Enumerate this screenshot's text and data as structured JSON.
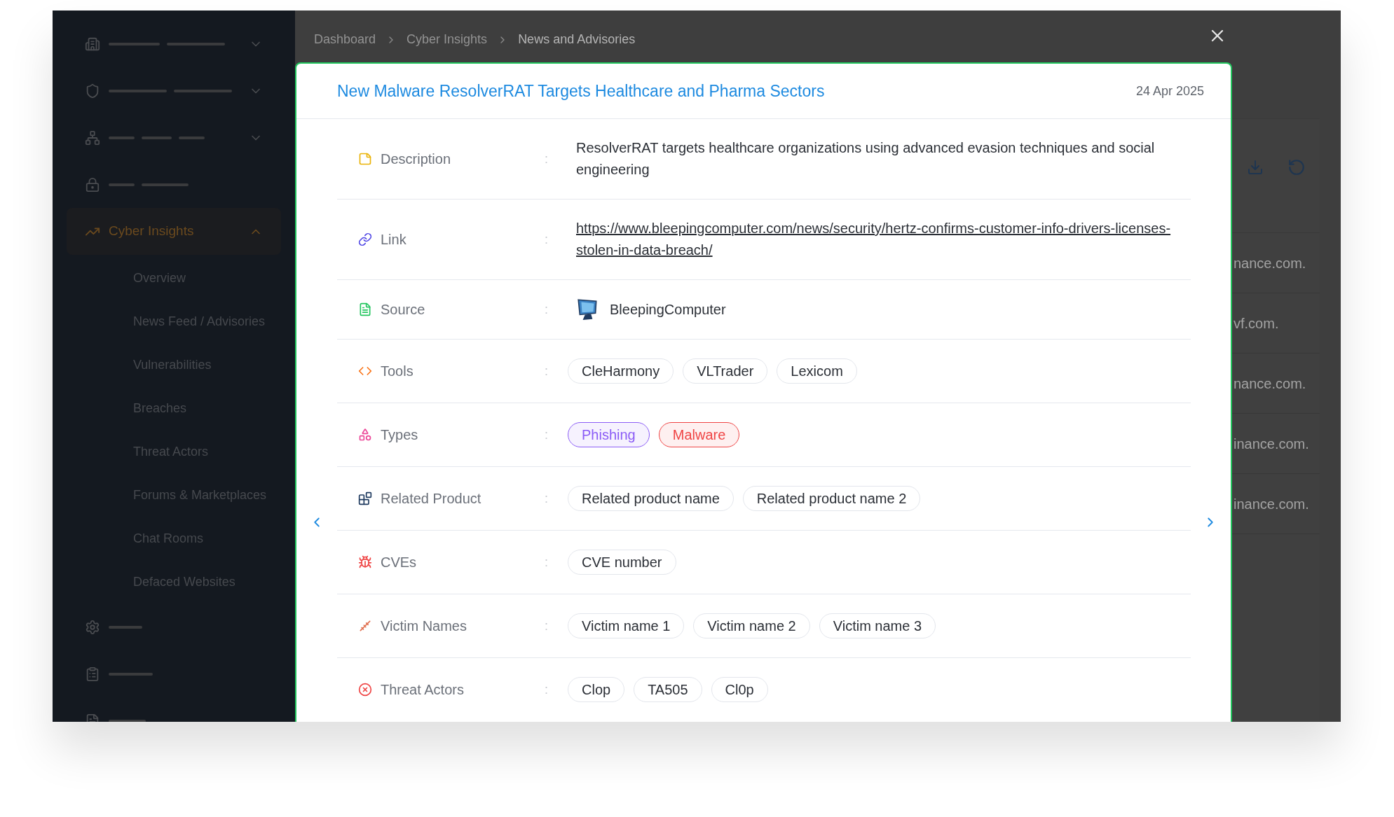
{
  "sidebar": {
    "items": [
      {
        "kind": "group",
        "expanded": false
      },
      {
        "kind": "group",
        "expanded": false
      },
      {
        "kind": "group",
        "expanded": false
      },
      {
        "kind": "link"
      },
      {
        "kind": "group",
        "label": "Cyber Insights",
        "expanded": true,
        "selected": true,
        "children": [
          {
            "label": "Overview"
          },
          {
            "label": "News Feed / Advisories"
          },
          {
            "label": "Vulnerabilities"
          },
          {
            "label": "Breaches"
          },
          {
            "label": "Threat Actors"
          },
          {
            "label": "Forums & Marketplaces"
          },
          {
            "label": "Chat Rooms"
          },
          {
            "label": "Defaced Websites"
          }
        ]
      },
      {
        "kind": "link"
      },
      {
        "kind": "link"
      },
      {
        "kind": "link"
      }
    ]
  },
  "breadcrumb": [
    "Dashboard",
    "Cyber Insights",
    "News and Advisories"
  ],
  "background_table": {
    "rows": [
      "nance.com.",
      "vf.com.",
      "nance.com.",
      "inance.com.",
      "inance.com."
    ]
  },
  "modal": {
    "title": "New Malware ResolverRAT Targets Healthcare and Pharma Sectors",
    "date": "24 Apr 2025",
    "rows": [
      {
        "kind": "text",
        "label": "Description",
        "separator": ":",
        "value": "ResolverRAT targets healthcare organizations using advanced evasion techniques and social engineering"
      },
      {
        "kind": "link",
        "label": "Link",
        "separator": ":",
        "value": "https://www.bleepingcomputer.com/news/security/hertz-confirms-customer-info-drivers-licenses-stolen-in-data-breach/"
      },
      {
        "kind": "source",
        "label": "Source",
        "separator": ":",
        "value": "BleepingComputer"
      },
      {
        "kind": "tags",
        "label": "Tools",
        "separator": ":",
        "tags": [
          {
            "label": "CleHarmony"
          },
          {
            "label": "VLTrader"
          },
          {
            "label": "Lexicom"
          }
        ]
      },
      {
        "kind": "tags",
        "label": "Types",
        "separator": ":",
        "tags": [
          {
            "label": "Phishing",
            "color": "#8b5cf6"
          },
          {
            "label": "Malware",
            "color": "#ef4444"
          }
        ]
      },
      {
        "kind": "tags",
        "label": "Related Product",
        "separator": ":",
        "tags": [
          {
            "label": "Related product name"
          },
          {
            "label": "Related product name 2"
          }
        ]
      },
      {
        "kind": "tags",
        "label": "CVEs",
        "separator": ":",
        "tags": [
          {
            "label": "CVE number"
          }
        ]
      },
      {
        "kind": "tags",
        "label": "Victim Names",
        "separator": ":",
        "tags": [
          {
            "label": "Victim name 1"
          },
          {
            "label": "Victim name 2"
          },
          {
            "label": "Victim name 3"
          }
        ]
      },
      {
        "kind": "tags",
        "label": "Threat Actors",
        "separator": ":",
        "tags": [
          {
            "label": "Clop"
          },
          {
            "label": "TA505"
          },
          {
            "label": "Cl0p"
          }
        ]
      }
    ]
  }
}
